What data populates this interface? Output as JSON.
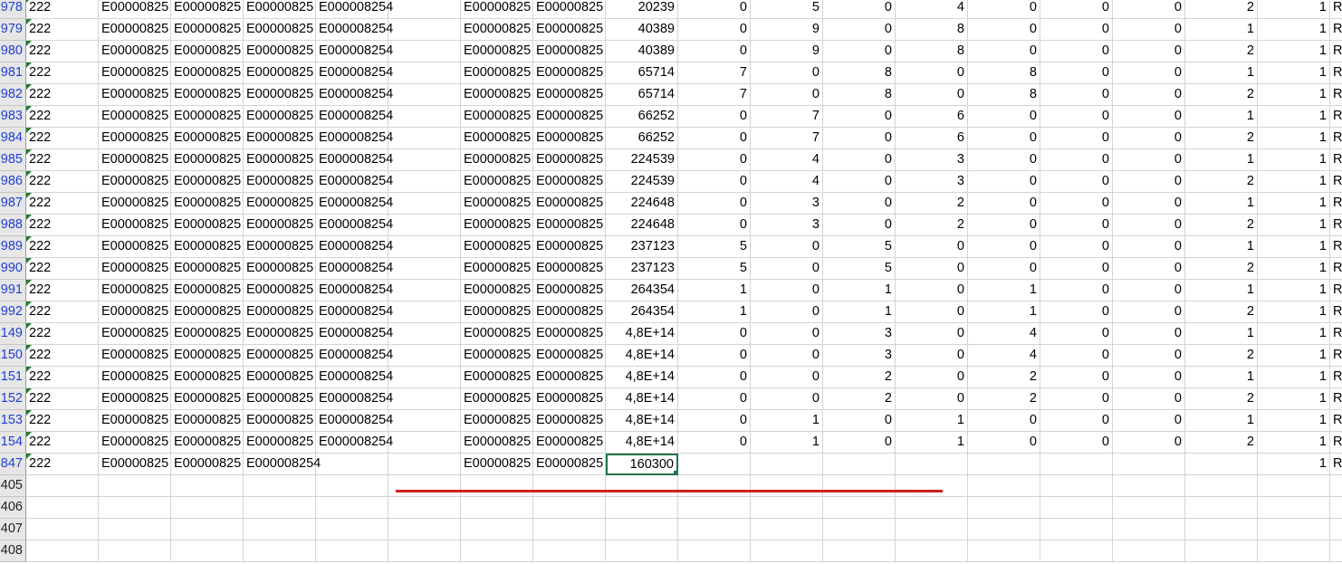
{
  "colors": {
    "grid_line": "#d4d4d4",
    "row_header_bg": "#e6e6e6",
    "row_header_filtered_text": "#1f3fd6",
    "selected_cell_border": "#217346",
    "error_triangle": "#1e7d32",
    "red_annotation_line": "#d02020"
  },
  "rows": [
    {
      "hdr": "978",
      "filtered": true,
      "a": "222",
      "b": "E00000825",
      "c": "E00000825",
      "d": "E00000825",
      "e": "E000008254",
      "g": "E00000825",
      "h": "E00000825",
      "i": "20239",
      "vals": [
        "0",
        "5",
        "0",
        "4",
        "0",
        "0",
        "0",
        "2",
        "1"
      ],
      "w": "R"
    },
    {
      "hdr": "979",
      "filtered": true,
      "a": "222",
      "b": "E00000825",
      "c": "E00000825",
      "d": "E00000825",
      "e": "E000008254",
      "g": "E00000825",
      "h": "E00000825",
      "i": "40389",
      "vals": [
        "0",
        "9",
        "0",
        "8",
        "0",
        "0",
        "0",
        "1",
        "1"
      ],
      "w": "R"
    },
    {
      "hdr": "980",
      "filtered": true,
      "a": "222",
      "b": "E00000825",
      "c": "E00000825",
      "d": "E00000825",
      "e": "E000008254",
      "g": "E00000825",
      "h": "E00000825",
      "i": "40389",
      "vals": [
        "0",
        "9",
        "0",
        "8",
        "0",
        "0",
        "0",
        "2",
        "1"
      ],
      "w": "R"
    },
    {
      "hdr": "981",
      "filtered": true,
      "a": "222",
      "b": "E00000825",
      "c": "E00000825",
      "d": "E00000825",
      "e": "E000008254",
      "g": "E00000825",
      "h": "E00000825",
      "i": "65714",
      "vals": [
        "7",
        "0",
        "8",
        "0",
        "8",
        "0",
        "0",
        "1",
        "1"
      ],
      "w": "R"
    },
    {
      "hdr": "982",
      "filtered": true,
      "a": "222",
      "b": "E00000825",
      "c": "E00000825",
      "d": "E00000825",
      "e": "E000008254",
      "g": "E00000825",
      "h": "E00000825",
      "i": "65714",
      "vals": [
        "7",
        "0",
        "8",
        "0",
        "8",
        "0",
        "0",
        "2",
        "1"
      ],
      "w": "R"
    },
    {
      "hdr": "983",
      "filtered": true,
      "a": "222",
      "b": "E00000825",
      "c": "E00000825",
      "d": "E00000825",
      "e": "E000008254",
      "g": "E00000825",
      "h": "E00000825",
      "i": "66252",
      "vals": [
        "0",
        "7",
        "0",
        "6",
        "0",
        "0",
        "0",
        "1",
        "1"
      ],
      "w": "R"
    },
    {
      "hdr": "984",
      "filtered": true,
      "a": "222",
      "b": "E00000825",
      "c": "E00000825",
      "d": "E00000825",
      "e": "E000008254",
      "g": "E00000825",
      "h": "E00000825",
      "i": "66252",
      "vals": [
        "0",
        "7",
        "0",
        "6",
        "0",
        "0",
        "0",
        "2",
        "1"
      ],
      "w": "R"
    },
    {
      "hdr": "985",
      "filtered": true,
      "a": "222",
      "b": "E00000825",
      "c": "E00000825",
      "d": "E00000825",
      "e": "E000008254",
      "g": "E00000825",
      "h": "E00000825",
      "i": "224539",
      "vals": [
        "0",
        "4",
        "0",
        "3",
        "0",
        "0",
        "0",
        "1",
        "1"
      ],
      "w": "R"
    },
    {
      "hdr": "986",
      "filtered": true,
      "a": "222",
      "b": "E00000825",
      "c": "E00000825",
      "d": "E00000825",
      "e": "E000008254",
      "g": "E00000825",
      "h": "E00000825",
      "i": "224539",
      "vals": [
        "0",
        "4",
        "0",
        "3",
        "0",
        "0",
        "0",
        "2",
        "1"
      ],
      "w": "R"
    },
    {
      "hdr": "987",
      "filtered": true,
      "a": "222",
      "b": "E00000825",
      "c": "E00000825",
      "d": "E00000825",
      "e": "E000008254",
      "g": "E00000825",
      "h": "E00000825",
      "i": "224648",
      "vals": [
        "0",
        "3",
        "0",
        "2",
        "0",
        "0",
        "0",
        "1",
        "1"
      ],
      "w": "R"
    },
    {
      "hdr": "988",
      "filtered": true,
      "a": "222",
      "b": "E00000825",
      "c": "E00000825",
      "d": "E00000825",
      "e": "E000008254",
      "g": "E00000825",
      "h": "E00000825",
      "i": "224648",
      "vals": [
        "0",
        "3",
        "0",
        "2",
        "0",
        "0",
        "0",
        "2",
        "1"
      ],
      "w": "R"
    },
    {
      "hdr": "989",
      "filtered": true,
      "a": "222",
      "b": "E00000825",
      "c": "E00000825",
      "d": "E00000825",
      "e": "E000008254",
      "g": "E00000825",
      "h": "E00000825",
      "i": "237123",
      "vals": [
        "5",
        "0",
        "5",
        "0",
        "0",
        "0",
        "0",
        "1",
        "1"
      ],
      "w": "R"
    },
    {
      "hdr": "990",
      "filtered": true,
      "a": "222",
      "b": "E00000825",
      "c": "E00000825",
      "d": "E00000825",
      "e": "E000008254",
      "g": "E00000825",
      "h": "E00000825",
      "i": "237123",
      "vals": [
        "5",
        "0",
        "5",
        "0",
        "0",
        "0",
        "0",
        "2",
        "1"
      ],
      "w": "R"
    },
    {
      "hdr": "991",
      "filtered": true,
      "a": "222",
      "b": "E00000825",
      "c": "E00000825",
      "d": "E00000825",
      "e": "E000008254",
      "g": "E00000825",
      "h": "E00000825",
      "i": "264354",
      "vals": [
        "1",
        "0",
        "1",
        "0",
        "1",
        "0",
        "0",
        "1",
        "1"
      ],
      "w": "R"
    },
    {
      "hdr": "992",
      "filtered": true,
      "a": "222",
      "b": "E00000825",
      "c": "E00000825",
      "d": "E00000825",
      "e": "E000008254",
      "g": "E00000825",
      "h": "E00000825",
      "i": "264354",
      "vals": [
        "1",
        "0",
        "1",
        "0",
        "1",
        "0",
        "0",
        "2",
        "1"
      ],
      "w": "R"
    },
    {
      "hdr": "149",
      "filtered": true,
      "a": "222",
      "b": "E00000825",
      "c": "E00000825",
      "d": "E00000825",
      "e": "E000008254",
      "g": "E00000825",
      "h": "E00000825",
      "i": "4,8E+14",
      "vals": [
        "0",
        "0",
        "3",
        "0",
        "4",
        "0",
        "0",
        "1",
        "1"
      ],
      "w": "R"
    },
    {
      "hdr": "150",
      "filtered": true,
      "a": "222",
      "b": "E00000825",
      "c": "E00000825",
      "d": "E00000825",
      "e": "E000008254",
      "g": "E00000825",
      "h": "E00000825",
      "i": "4,8E+14",
      "vals": [
        "0",
        "0",
        "3",
        "0",
        "4",
        "0",
        "0",
        "2",
        "1"
      ],
      "w": "R"
    },
    {
      "hdr": "151",
      "filtered": true,
      "a": "222",
      "b": "E00000825",
      "c": "E00000825",
      "d": "E00000825",
      "e": "E000008254",
      "g": "E00000825",
      "h": "E00000825",
      "i": "4,8E+14",
      "vals": [
        "0",
        "0",
        "2",
        "0",
        "2",
        "0",
        "0",
        "1",
        "1"
      ],
      "w": "R"
    },
    {
      "hdr": "152",
      "filtered": true,
      "a": "222",
      "b": "E00000825",
      "c": "E00000825",
      "d": "E00000825",
      "e": "E000008254",
      "g": "E00000825",
      "h": "E00000825",
      "i": "4,8E+14",
      "vals": [
        "0",
        "0",
        "2",
        "0",
        "2",
        "0",
        "0",
        "2",
        "1"
      ],
      "w": "R"
    },
    {
      "hdr": "153",
      "filtered": true,
      "a": "222",
      "b": "E00000825",
      "c": "E00000825",
      "d": "E00000825",
      "e": "E000008254",
      "g": "E00000825",
      "h": "E00000825",
      "i": "4,8E+14",
      "vals": [
        "0",
        "1",
        "0",
        "1",
        "0",
        "0",
        "0",
        "1",
        "1"
      ],
      "w": "R"
    },
    {
      "hdr": "154",
      "filtered": true,
      "a": "222",
      "b": "E00000825",
      "c": "E00000825",
      "d": "E00000825",
      "e": "E000008254",
      "g": "E00000825",
      "h": "E00000825",
      "i": "4,8E+14",
      "vals": [
        "0",
        "1",
        "0",
        "1",
        "0",
        "0",
        "0",
        "2",
        "1"
      ],
      "w": "R"
    },
    {
      "hdr": "847",
      "filtered": true,
      "a": "222",
      "b": "E00000825",
      "c": "E00000825",
      "d": "E000008254",
      "e": "",
      "g": "E00000825",
      "h": "E00000825",
      "i": "160300",
      "vals": [
        "",
        "",
        "",
        "",
        "",
        "",
        "",
        "",
        "1"
      ],
      "w": "R",
      "selected_i": true
    },
    {
      "hdr": "405",
      "filtered": false
    },
    {
      "hdr": "406",
      "filtered": false
    },
    {
      "hdr": "407",
      "filtered": false
    },
    {
      "hdr": "408",
      "filtered": false
    }
  ]
}
